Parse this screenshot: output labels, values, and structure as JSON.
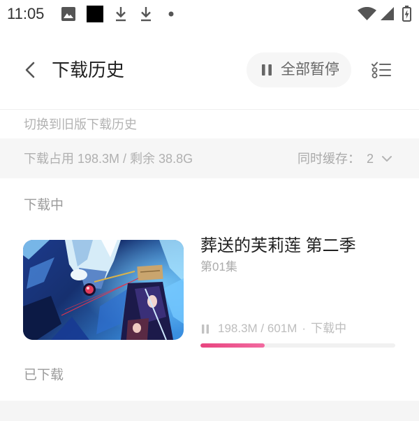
{
  "status_bar": {
    "time": "11:05",
    "notification_icons": [
      "gallery-icon",
      "black-square-icon",
      "download-icon",
      "download-icon",
      "dot-icon"
    ],
    "system_icons": [
      "wifi-icon",
      "signal-icon",
      "battery-charging-icon"
    ]
  },
  "header": {
    "back_icon": "chevron-left-icon",
    "title": "下载历史",
    "pause_all": {
      "icon": "pause-icon",
      "label": "全部暂停"
    },
    "manage_icon": "checklist-icon"
  },
  "switch_old_version": "切换到旧版下载历史",
  "storage_bar": {
    "usage_text": "下载占用 198.3M / 剩余 38.8G",
    "concurrent": {
      "label": "同时缓存：",
      "value": "2",
      "icon": "chevron-down-icon"
    }
  },
  "downloading": {
    "section_title": "下载中",
    "items": [
      {
        "title": "葬送的芙莉莲 第二季",
        "episode": "第01集",
        "state_icon": "pause-icon",
        "size_progress": "198.3M / 601M",
        "separator": "·",
        "status": "下载中",
        "progress": 0.33
      }
    ]
  },
  "downloaded": {
    "section_title": "已下载"
  },
  "colors": {
    "accent": "#e8447f",
    "text_primary": "#222222",
    "text_muted": "#aaaaaa",
    "band_background": "#f6f6f6",
    "pill_background": "#f6f6f6"
  }
}
